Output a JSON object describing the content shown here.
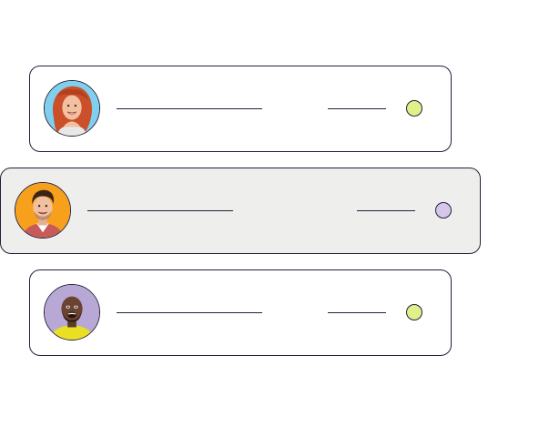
{
  "rows": [
    {
      "avatar": "woman-red-hair-avatar",
      "avatar_bg": "#7fd0ee",
      "status_color": "#e2f08a",
      "highlighted": false
    },
    {
      "avatar": "man-dark-hair-avatar",
      "avatar_bg": "#f7a01c",
      "status_color": "#d6c6ea",
      "highlighted": true
    },
    {
      "avatar": "man-yellow-shirt-avatar",
      "avatar_bg": "#b8a8d6",
      "status_color": "#e2f08a",
      "highlighted": false
    }
  ],
  "colors": {
    "border": "#23213a",
    "highlight_bg": "#eeeeec"
  }
}
